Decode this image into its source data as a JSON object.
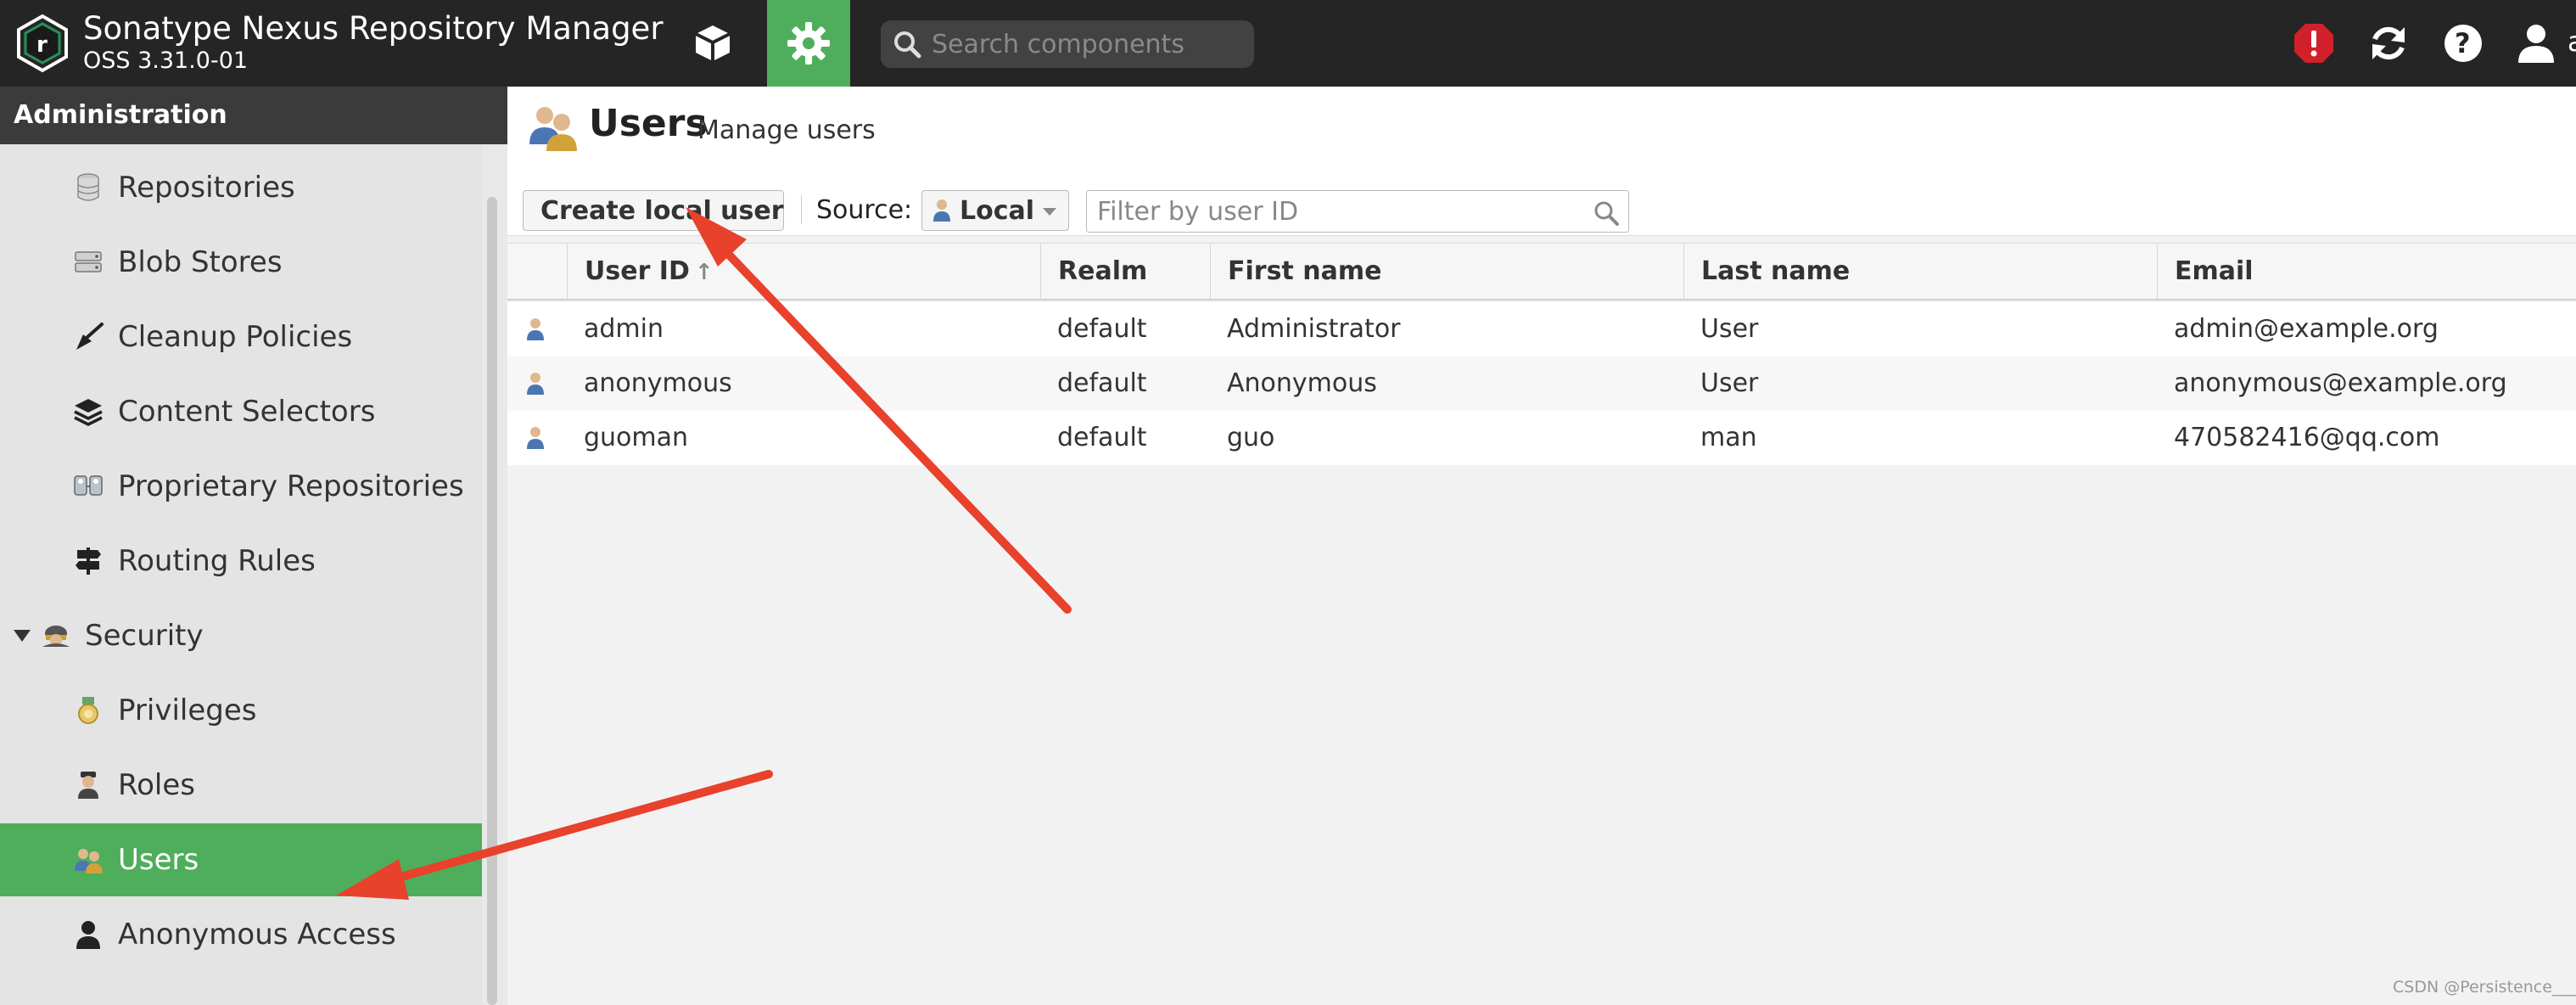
{
  "topbar": {
    "title": "Sonatype Nexus Repository Manager",
    "version": "OSS 3.31.0-01",
    "search_placeholder": "Search components",
    "user_initial": "a",
    "icons": [
      "browse-cube-icon",
      "admin-gear-icon",
      "alert-icon",
      "refresh-icon",
      "help-icon",
      "user-icon"
    ],
    "accent_color": "#4fae5c",
    "alert_color": "#d0212a"
  },
  "sidebar": {
    "header": "Administration",
    "items": [
      {
        "label": "Repositories",
        "icon": "database-icon"
      },
      {
        "label": "Blob Stores",
        "icon": "server-icon"
      },
      {
        "label": "Cleanup Policies",
        "icon": "broom-icon"
      },
      {
        "label": "Content Selectors",
        "icon": "layers-icon"
      },
      {
        "label": "Proprietary Repositories",
        "icon": "proprietary-icon"
      },
      {
        "label": "Routing Rules",
        "icon": "signpost-icon"
      },
      {
        "label": "Security",
        "icon": "security-icon",
        "group": true
      },
      {
        "label": "Privileges",
        "icon": "medal-icon"
      },
      {
        "label": "Roles",
        "icon": "role-icon"
      },
      {
        "label": "Users",
        "icon": "users-icon",
        "active": true
      },
      {
        "label": "Anonymous Access",
        "icon": "person-icon"
      }
    ]
  },
  "main": {
    "title": "Users",
    "subtitle": "Manage users",
    "toolbar": {
      "create_label": "Create local user",
      "source_label": "Source:",
      "source_value": "Local",
      "filter_placeholder": "Filter by user ID"
    },
    "table": {
      "columns": [
        "User ID",
        "Realm",
        "First name",
        "Last name",
        "Email"
      ],
      "sort_indicator": "↑",
      "rows": [
        {
          "user_id": "admin",
          "realm": "default",
          "first_name": "Administrator",
          "last_name": "User",
          "email": "admin@example.org"
        },
        {
          "user_id": "anonymous",
          "realm": "default",
          "first_name": "Anonymous",
          "last_name": "User",
          "email": "anonymous@example.org"
        },
        {
          "user_id": "guoman",
          "realm": "default",
          "first_name": "guo",
          "last_name": "man",
          "email": "470582416@qq.com"
        }
      ]
    }
  },
  "watermark": "CSDN @Persistence___",
  "annotation_color": "#e8412c"
}
